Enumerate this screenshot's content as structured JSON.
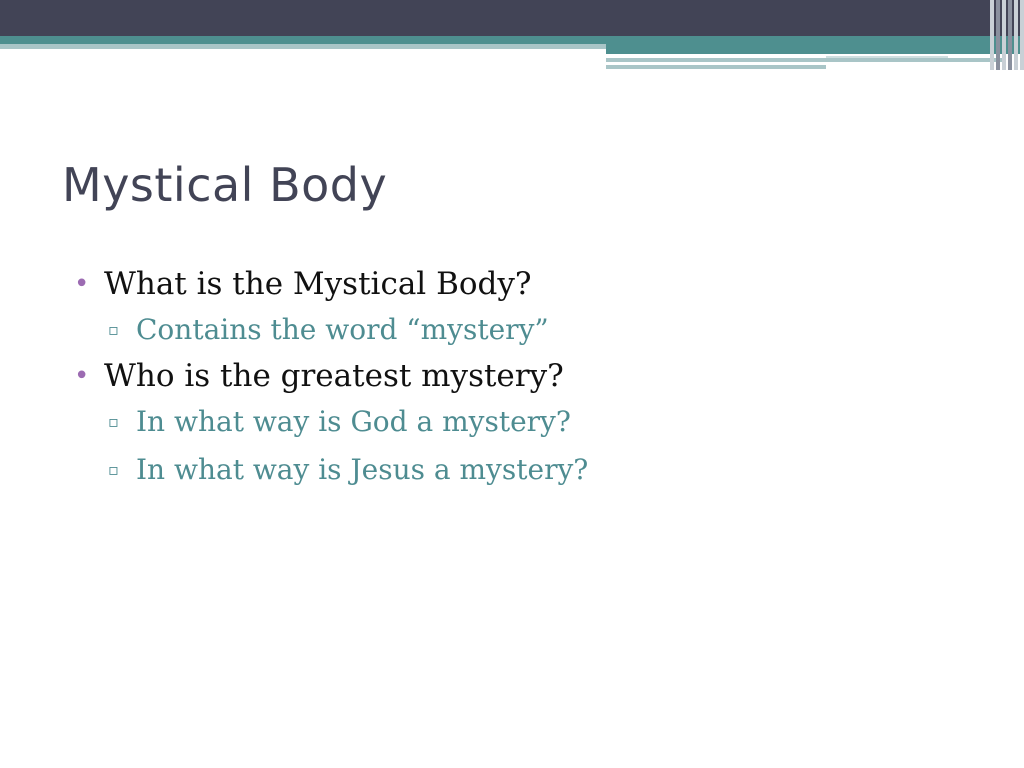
{
  "slide": {
    "title": "Mystical Body",
    "items": [
      {
        "text": "What is the Mystical Body?",
        "bullet": "•",
        "subitems": [
          {
            "text": "Contains the word “mystery”",
            "bullet": "▫"
          }
        ]
      },
      {
        "text": "Who is the greatest mystery?",
        "bullet": "•",
        "subitems": [
          {
            "text": "In what way is God a mystery?",
            "bullet": "▫"
          },
          {
            "text": "In what way is Jesus a mystery?",
            "bullet": "▫"
          }
        ]
      }
    ]
  },
  "theme": {
    "header_dark": "#424456",
    "header_teal": "#4e8f8f",
    "header_light": "#a9c5c7",
    "title_color": "#424456",
    "bullet_color": "#9c6bb2",
    "subtext_color": "#4e8c91"
  }
}
